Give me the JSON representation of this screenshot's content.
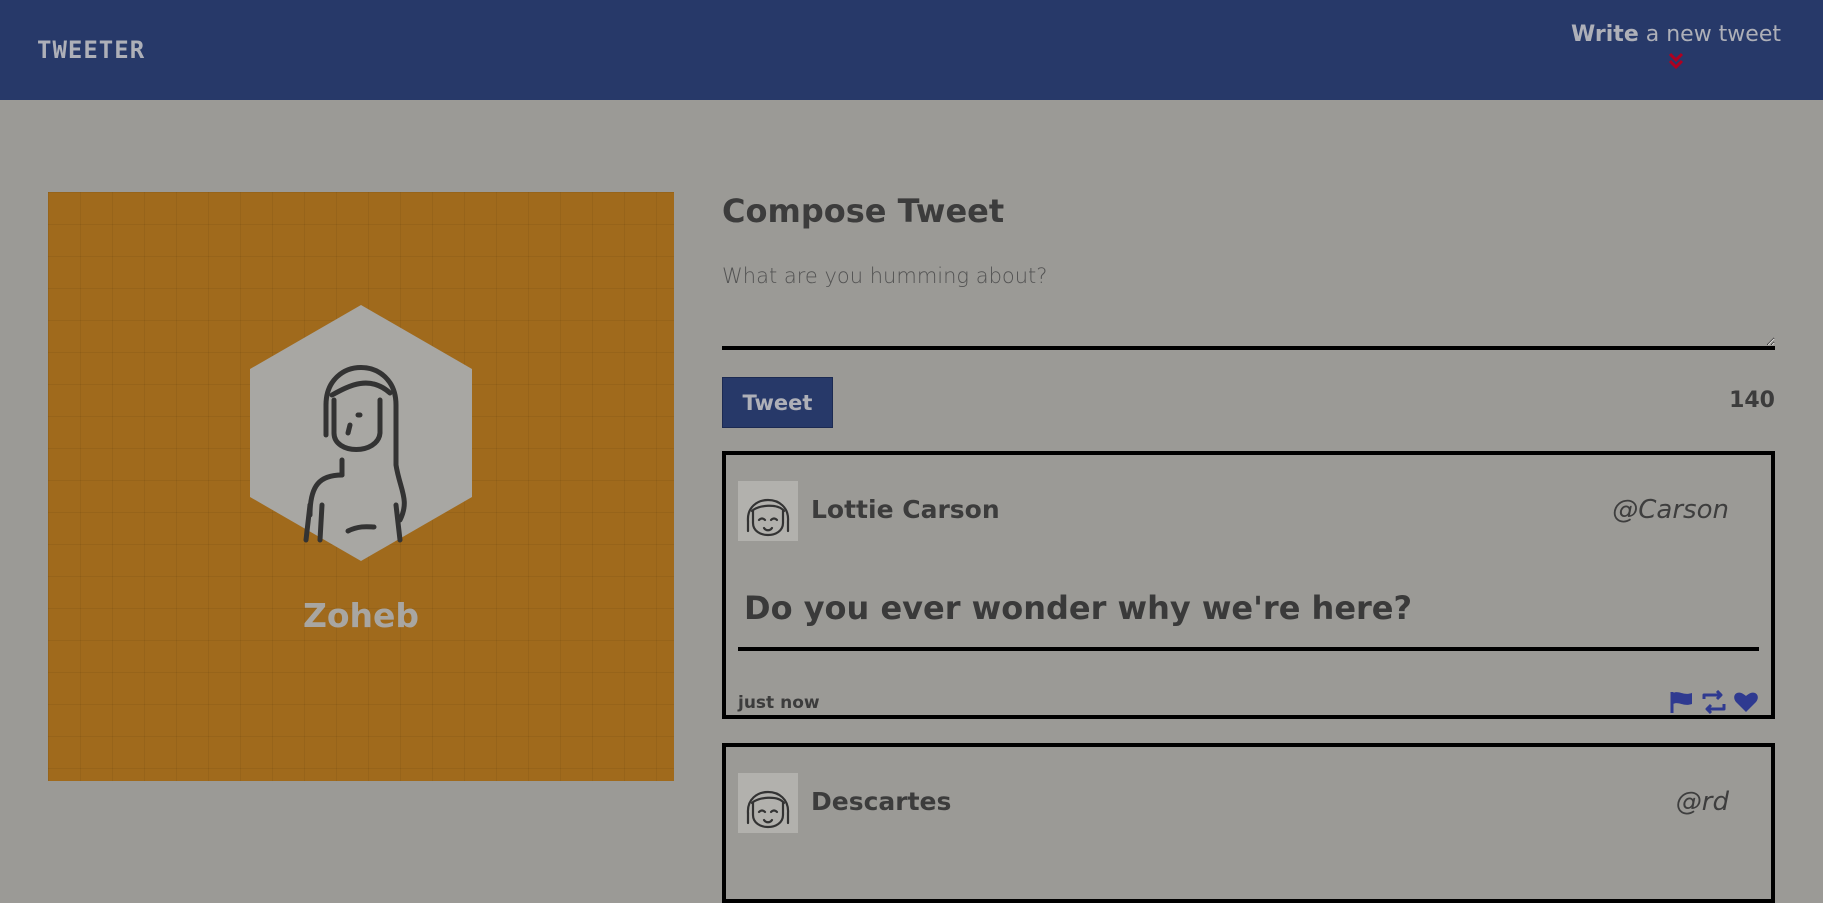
{
  "nav": {
    "brand": "TWEETER",
    "write_bold": "Write",
    "write_rest": " a new tweet",
    "toggle_icon": "double-chevron-down",
    "toggle_color": "#b00020"
  },
  "profile": {
    "name": "Zoheb",
    "avatar_icon": "woman-avatar"
  },
  "compose": {
    "title": "Compose Tweet",
    "placeholder": "What are you humming about?",
    "value": "",
    "button_label": "Tweet",
    "counter": "140"
  },
  "tweets": [
    {
      "name": "Lottie Carson",
      "handle": "@Carson",
      "content": "Do you ever wonder why we're here?",
      "time": "just now",
      "avatar_icon": "girl-face-avatar",
      "action_icons": [
        "flag",
        "retweet",
        "heart"
      ]
    },
    {
      "name": "Descartes",
      "handle": "@rd",
      "avatar_icon": "girl-face-avatar"
    }
  ],
  "colors": {
    "nav": "#273969",
    "background": "#9b9a96",
    "profile_bg": "#a06a1c",
    "action_icon": "#2f3a90"
  }
}
